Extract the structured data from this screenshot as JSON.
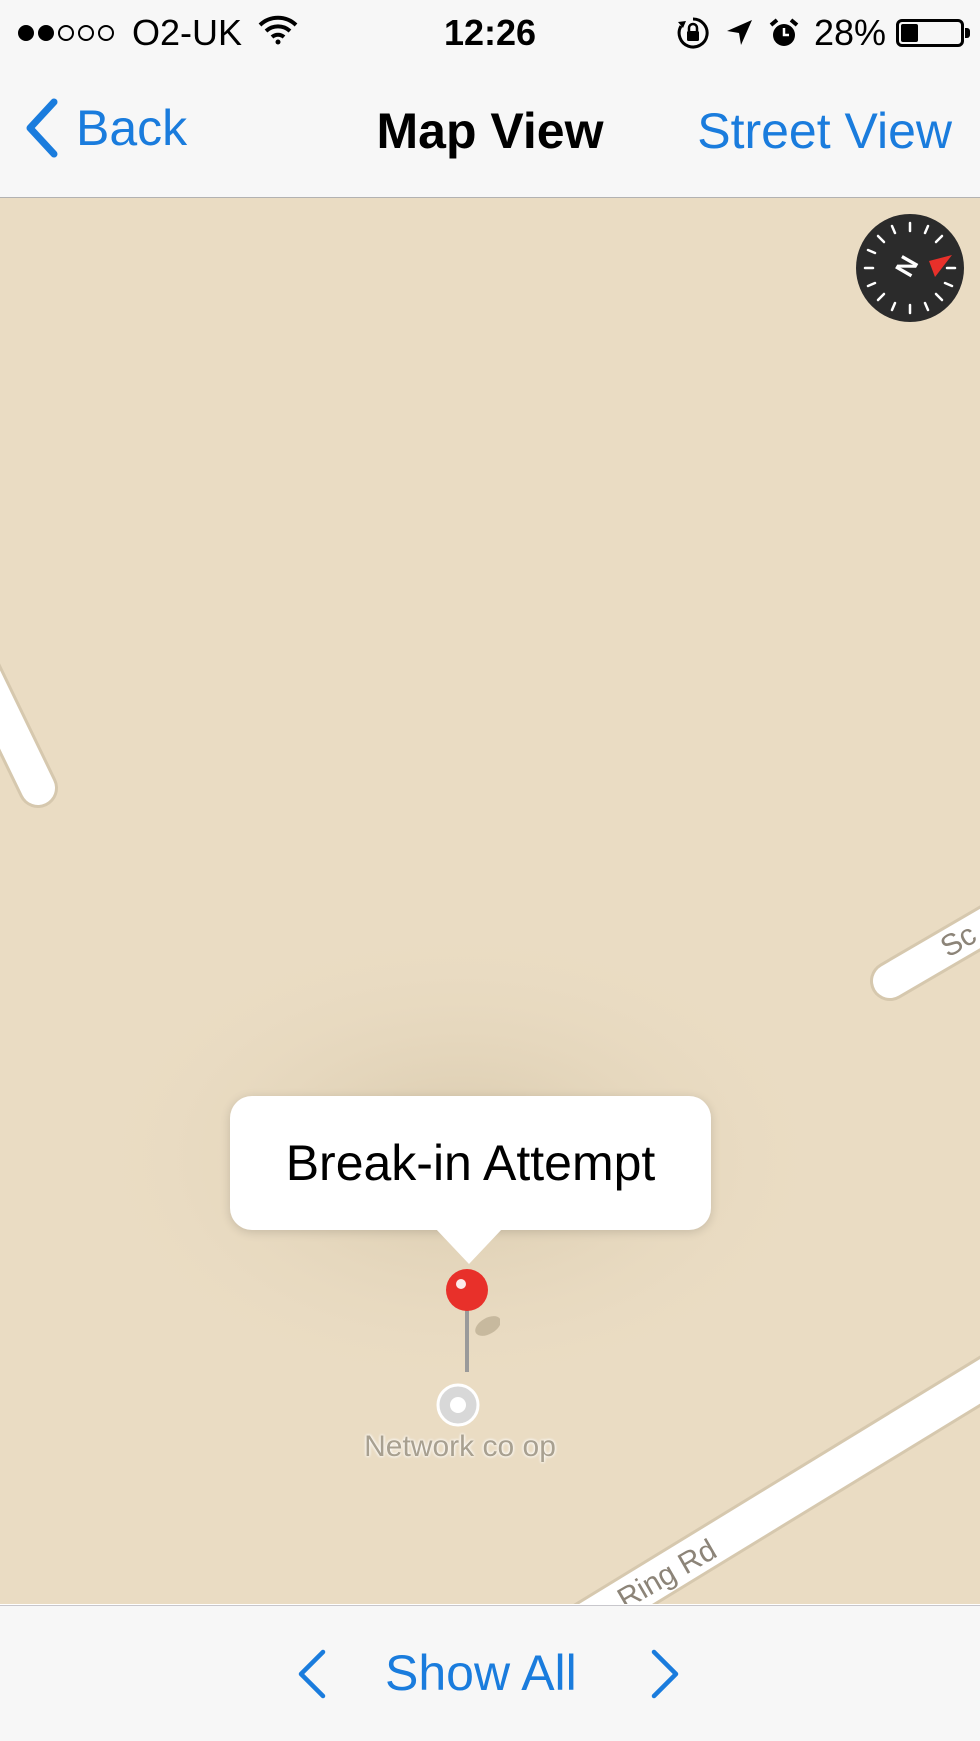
{
  "status_bar": {
    "carrier": "O2-UK",
    "time": "12:26",
    "battery_percent": "28%",
    "battery_level": 0.28,
    "signal_bars_filled": 2,
    "signal_bars_total": 5,
    "icons": [
      "wifi-icon",
      "rotation-lock-icon",
      "location-arrow-icon",
      "alarm-icon",
      "battery-icon"
    ]
  },
  "nav_bar": {
    "back_label": "Back",
    "title": "Map View",
    "right_label": "Street View"
  },
  "map": {
    "callout_title": "Break-in Attempt",
    "poi_label": "Network co op",
    "road_label": "Ring Rd",
    "road_label_partial": "Sc",
    "compass_letter": "N"
  },
  "toolbar": {
    "show_all_label": "Show All",
    "icons": [
      "chevron-left-icon",
      "chevron-right-icon"
    ]
  },
  "colors": {
    "accent": "#1a7cdd",
    "map_background": "#eadcc3",
    "pin_red": "#e8302a",
    "bar_background": "#f7f7f7"
  }
}
